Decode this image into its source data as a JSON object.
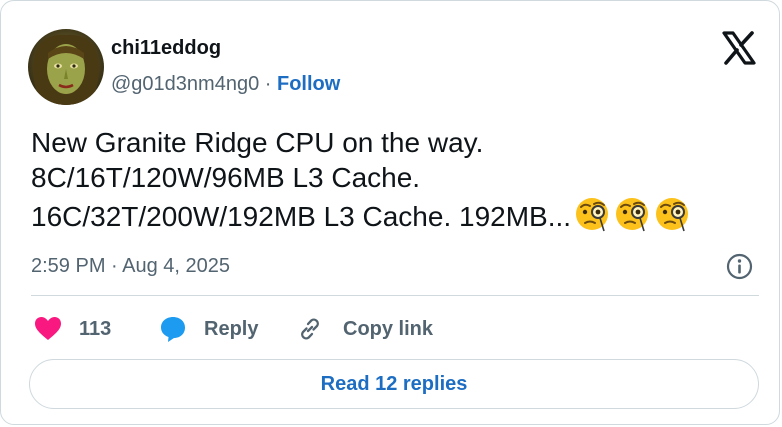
{
  "author": {
    "display_name": "chi11eddog",
    "handle": "@g01d3nm4ng0",
    "separator": "·",
    "follow_label": "Follow"
  },
  "tweet": {
    "lines": [
      "New Granite Ridge CPU on the way.",
      "8C/16T/120W/96MB L3 Cache.",
      "16C/32T/200W/192MB L3 Cache. 192MB..."
    ],
    "emojis": [
      "face-with-monocle-emoji",
      "face-with-monocle-emoji",
      "face-with-monocle-emoji"
    ],
    "timestamp": "2:59 PM · Aug 4, 2025"
  },
  "actions": {
    "like_count": "113",
    "reply_label": "Reply",
    "copy_link_label": "Copy link"
  },
  "read_replies_label": "Read 12 replies",
  "icons": {
    "brand_logo": "x-logo-icon",
    "info": "info-icon",
    "like": "heart-icon",
    "reply": "speech-bubble-icon",
    "copy": "link-icon"
  },
  "colors": {
    "link": "#1d6ec3",
    "heart": "#f91880",
    "reply_bubble": "#1d9bf0",
    "muted": "#536471",
    "border": "#cfd9de"
  }
}
